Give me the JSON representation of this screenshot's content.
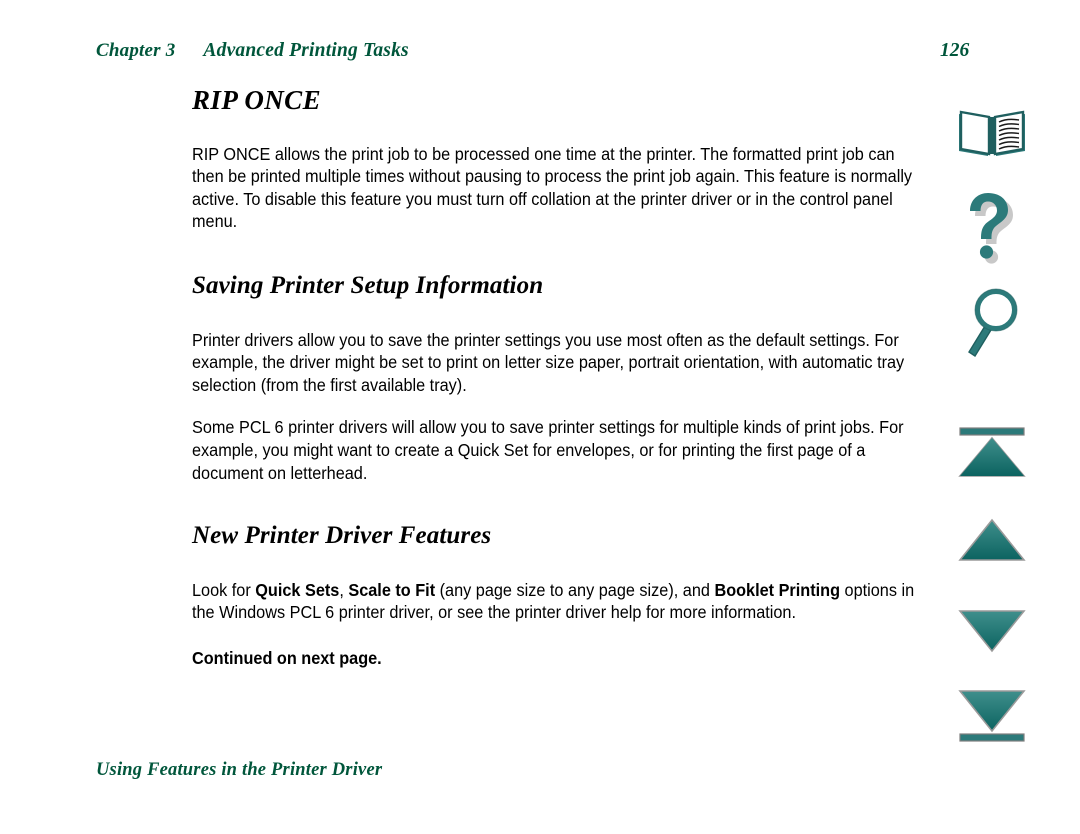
{
  "document": {
    "header": {
      "chapter": "Chapter 3",
      "title": "Advanced Printing Tasks",
      "page_number": "126"
    },
    "footer": {
      "text": "Using Features in the Printer Driver"
    },
    "colors": {
      "heading_green": "#00563B",
      "icon_teal": "#2C7A7A",
      "body_black": "#000000",
      "page_background": "#FFFFFF"
    },
    "sections": [
      {
        "heading": "RIP ONCE",
        "paragraphs": [
          "RIP ONCE allows the print job to be processed one time at the printer. The formatted print job can then be printed multiple times without pausing to process the print job again. This feature is normally active. To disable this feature you must turn off collation at the printer driver or in the control panel menu."
        ]
      },
      {
        "heading": "Saving Printer Setup Information",
        "paragraphs": [
          "Printer drivers allow you to save the printer settings you use most often as the default settings. For example, the driver might be set to print on letter size paper, portrait orientation, with automatic tray selection (from the first available tray).",
          "Some PCL 6 printer drivers will allow you to save printer settings for multiple kinds of print jobs. For example, you might want to create a Quick Set for envelopes, or for printing the first page of a document on letterhead."
        ]
      },
      {
        "heading": "New Printer Driver Features",
        "rich_paragraph": {
          "part1": "Look for ",
          "bold1": "Quick Sets",
          "part2": ", ",
          "bold2": "Scale to Fit",
          "part3": " (any page size to any page size), and ",
          "bold3": "Booklet Printing",
          "part4": " options in the Windows PCL 6 printer driver, or see the printer driver help for more information."
        },
        "continued_note": "Continued on next page."
      }
    ]
  },
  "nav_rail": {
    "items": [
      {
        "name": "table-of-contents-icon",
        "label": "Table of Contents"
      },
      {
        "name": "help-icon",
        "label": "Help"
      },
      {
        "name": "search-icon",
        "label": "Search"
      },
      {
        "name": "go-to-first-page-icon",
        "label": "Go to first page"
      },
      {
        "name": "previous-page-icon",
        "label": "Previous page"
      },
      {
        "name": "next-page-icon",
        "label": "Next page"
      },
      {
        "name": "go-to-last-page-icon",
        "label": "Go to last page"
      }
    ]
  }
}
